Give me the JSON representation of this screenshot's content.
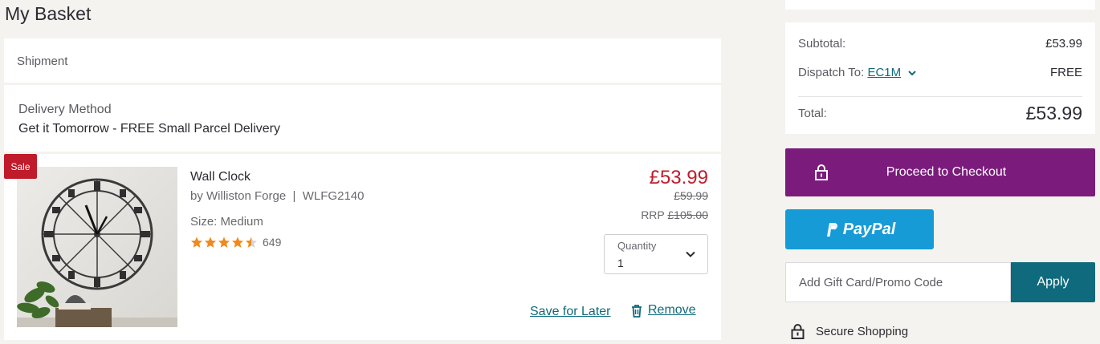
{
  "page": {
    "title": "My Basket"
  },
  "shipment": {
    "label": "Shipment"
  },
  "delivery": {
    "label": "Delivery Method",
    "value": "Get it Tomorrow - FREE Small Parcel Delivery"
  },
  "item": {
    "badge": "Sale",
    "name": "Wall Clock",
    "brand_line": "by Williston Forge  |  WLFG2140",
    "size": "Size: Medium",
    "rating": 4.5,
    "rating_count": "649",
    "price": "£53.99",
    "was_price": "£59.99",
    "rrp_label": "RRP",
    "rrp_price": "£105.00",
    "quantity_label": "Quantity",
    "quantity_value": "1",
    "save_later": "Save for Later",
    "remove": "Remove"
  },
  "summary": {
    "subtotal_label": "Subtotal:",
    "subtotal_value": "£53.99",
    "dispatch_label": "Dispatch To:",
    "dispatch_postcode": "EC1M",
    "dispatch_value": "FREE",
    "total_label": "Total:",
    "total_value": "£53.99"
  },
  "actions": {
    "checkout_label": "Proceed to Checkout",
    "paypal_label": "PayPal",
    "promo_placeholder": "Add Gift Card/Promo Code",
    "apply_label": "Apply"
  },
  "footer": {
    "secure_label": "Secure Shopping"
  },
  "icons": {
    "rating_star": "star-icon",
    "quantity": "chevron-down-icon",
    "dispatch": "chevron-down-icon",
    "remove": "trash-icon",
    "checkout": "lock-icon",
    "paypal": "paypal-logo-icon",
    "secure": "lock-icon"
  },
  "colors": {
    "sale_red": "#c01b2a",
    "checkout_purple": "#7b1c7d",
    "paypal_blue": "#169bd7",
    "link_teal": "#0e6a7c",
    "star_orange": "#f08a1d"
  }
}
